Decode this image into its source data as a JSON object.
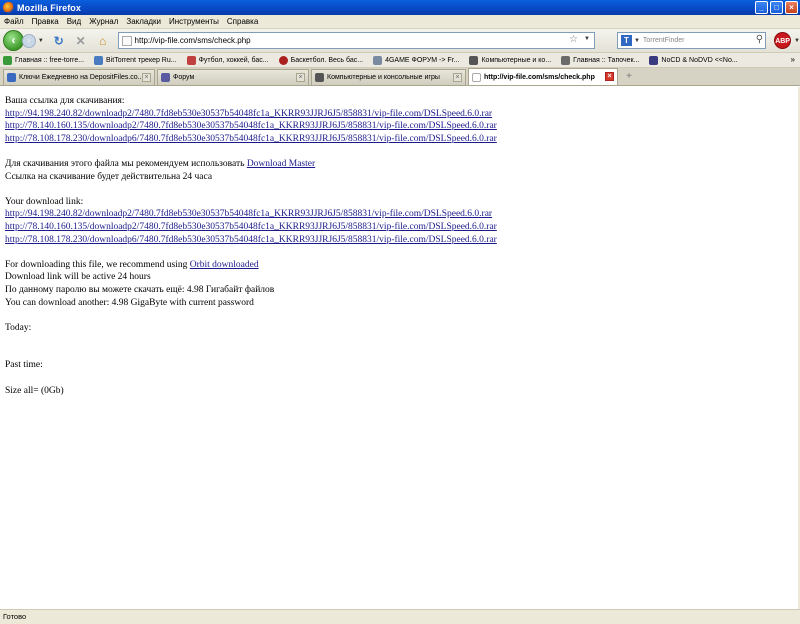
{
  "window": {
    "title": "Mozilla Firefox"
  },
  "menu": [
    "Файл",
    "Правка",
    "Вид",
    "Журнал",
    "Закладки",
    "Инструменты",
    "Справка"
  ],
  "nav": {
    "url": "http://vip-file.com/sms/check.php",
    "search_placeholder": "TorrentFinder",
    "search_engine_letter": "T",
    "adblock_label": "ABP"
  },
  "bookmarks": [
    {
      "label": "Главная :: free-torre...",
      "color": "#3a9a3a"
    },
    {
      "label": "BitTorrent трекер Ru...",
      "color": "#4a7ac0"
    },
    {
      "label": "Футбол, хоккей, бас...",
      "color": "#c04040"
    },
    {
      "label": "Баскетбол. Весь бас...",
      "color": "#aa2020"
    },
    {
      "label": "4GAME ФОРУМ -> Fr...",
      "color": "#7a8aa0"
    },
    {
      "label": "Компьютерные и ко...",
      "color": "#555555"
    },
    {
      "label": "Главная :: Тапочек...",
      "color": "#6a6a6a"
    },
    {
      "label": "NoCD & NoDVD <<No...",
      "color": "#3a3a80"
    }
  ],
  "bookmarks_more": "»",
  "tabs": [
    {
      "label": "Ключи Ежедневно на DepositFiles.co...",
      "active": false,
      "color": "#3a6ac0"
    },
    {
      "label": "Форум",
      "active": false,
      "color": "#5a5aa0"
    },
    {
      "label": "Компьютерные и консольные игры",
      "active": false,
      "color": "#555555"
    },
    {
      "label": "http://vip-file.com/sms/check.php",
      "active": true,
      "color": "#dddddd"
    }
  ],
  "content": {
    "ru_heading": "Ваша ссылка для скачивания:",
    "links": [
      "http://94.198.240.82/downloadp2/7480.7fd8eb530e30537b54048fc1a_KKRR93JJRJ6J5/858831/vip-file.com/DSLSpeed.6.0.rar",
      "http://78.140.160.135/downloadp2/7480.7fd8eb530e30537b54048fc1a_KKRR93JJRJ6J5/858831/vip-file.com/DSLSpeed.6.0.rar",
      "http://78.108.178.230/downloadp6/7480.7fd8eb530e30537b54048fc1a_KKRR93JJRJ6J5/858831/vip-file.com/DSLSpeed.6.0.rar"
    ],
    "ru_recommend": "Для скачивания этого файла мы рекомендуем использовать",
    "ru_recommend_link": "Download Master",
    "ru_active": "Ссылка на скачивание будет действительна 24 часа",
    "en_heading": "Your download link:",
    "en_recommend": "For downloading this file, we recommend using",
    "en_recommend_link": "Orbit downloaded",
    "en_active": "Download link will be active 24 hours",
    "ru_remaining": "По данному паролю вы можете скачать ещё: 4.98 Гигабайт файлов",
    "en_remaining": "You can download another: 4.98 GigaByte with current password",
    "today": "Today:",
    "past_time": "Past time:",
    "size_all": "Size all= (0Gb)"
  },
  "status": "Готово"
}
